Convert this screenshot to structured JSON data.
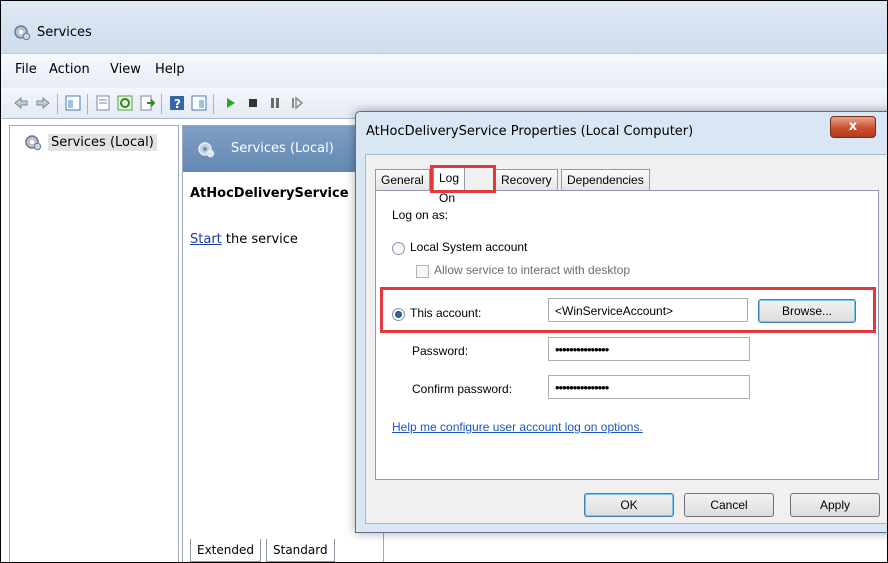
{
  "window": {
    "title": "Services"
  },
  "menu": {
    "items": [
      "File",
      "Action",
      "View",
      "Help"
    ]
  },
  "toolbar": {
    "icons": [
      "back-arrow-icon",
      "forward-arrow-icon",
      "console-tree-icon",
      "properties-icon",
      "refresh-icon",
      "export-icon",
      "help-icon",
      "show-hide-icon",
      "play-icon",
      "stop-icon",
      "pause-icon",
      "resume-icon"
    ]
  },
  "tree": {
    "root_label": "Services (Local)"
  },
  "center": {
    "header": "Services (Local)",
    "service_name": "AtHocDeliveryService",
    "start_link": "Start",
    "start_suffix": " the service",
    "tabs": [
      "Extended",
      "Standard"
    ]
  },
  "dialog": {
    "title": "AtHocDeliveryService Properties (Local Computer)",
    "close_label": "x",
    "tabs": [
      "General",
      "Log On",
      "Recovery",
      "Dependencies"
    ],
    "active_tab": "Log On",
    "logon_as_label": "Log on as:",
    "local_system_label": "Local System account",
    "allow_interact_label": "Allow service to interact with desktop",
    "this_account_label": "This account:",
    "account_value": "<WinServiceAccount>",
    "browse_label": "Browse...",
    "password_label": "Password:",
    "password_value": "•••••••••••••••",
    "confirm_label": "Confirm password:",
    "confirm_value": "•••••••••••••••",
    "help_link": "Help me configure user account log on options.",
    "ok_label": "OK",
    "cancel_label": "Cancel",
    "apply_label": "Apply"
  },
  "colors": {
    "highlight_box": "#e0393e",
    "link": "#1d55c9",
    "pane_header": "#6f93bd"
  }
}
